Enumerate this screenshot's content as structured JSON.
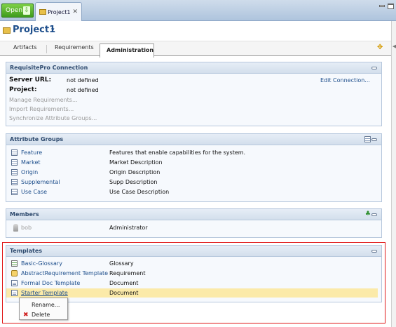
{
  "window": {
    "open_label": "Open",
    "open_arrow": "⇩",
    "tab_label": "Project1",
    "tab_close": "✕"
  },
  "header": {
    "project_title": "Project1",
    "caret": "▾"
  },
  "tabs": [
    {
      "label": "Artifacts",
      "active": false
    },
    {
      "label": "Requirements",
      "active": false
    },
    {
      "label": "Administration",
      "active": true
    }
  ],
  "tab_tool_icon": "pin-icon",
  "connection": {
    "title": "RequisitePro Connection",
    "server_label": "Server URL:",
    "server_value": "not defined",
    "project_label": "Project:",
    "project_value": "not defined",
    "edit_link": "Edit Connection...",
    "actions": [
      "Manage Requirements...",
      "Import Requirements...",
      "Synchronize Attribute Groups..."
    ]
  },
  "attribute_groups": {
    "title": "Attribute Groups",
    "items": [
      {
        "name": "Feature",
        "description": "Features that enable capabilities for the system."
      },
      {
        "name": "Market",
        "description": "Market Description"
      },
      {
        "name": "Origin",
        "description": "Origin Description"
      },
      {
        "name": "Supplemental",
        "description": "Supp Description"
      },
      {
        "name": "Use Case",
        "description": "Use Case Description"
      }
    ]
  },
  "members": {
    "title": "Members",
    "items": [
      {
        "name": "bob",
        "role": "Administrator"
      }
    ]
  },
  "templates": {
    "title": "Templates",
    "items": [
      {
        "name": "Basic-Glossary",
        "type": "Glossary",
        "icon": "glossary-icon"
      },
      {
        "name": "AbstractRequirement Template",
        "type": "Requirement",
        "icon": "requirement-icon"
      },
      {
        "name": "Formal Doc Template",
        "type": "Document",
        "icon": "document-icon"
      },
      {
        "name": "Starter Template",
        "type": "Document",
        "icon": "document-icon",
        "selected": true
      }
    ]
  },
  "context_menu": {
    "items": [
      "Rename...",
      "Delete"
    ],
    "delete_icon": "✖"
  },
  "colors": {
    "link": "#1e4f8c",
    "highlight": "#fbeaa9",
    "selection_frame": "#e01818"
  }
}
